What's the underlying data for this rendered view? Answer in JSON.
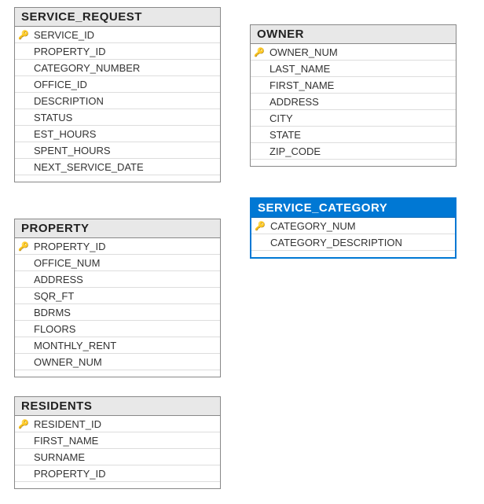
{
  "tables": {
    "service_request": {
      "title": "SERVICE_REQUEST",
      "columns": [
        {
          "name": "SERVICE_ID",
          "pk": true
        },
        {
          "name": "PROPERTY_ID",
          "pk": false
        },
        {
          "name": "CATEGORY_NUMBER",
          "pk": false
        },
        {
          "name": "OFFICE_ID",
          "pk": false
        },
        {
          "name": "DESCRIPTION",
          "pk": false
        },
        {
          "name": "STATUS",
          "pk": false
        },
        {
          "name": "EST_HOURS",
          "pk": false
        },
        {
          "name": "SPENT_HOURS",
          "pk": false
        },
        {
          "name": "NEXT_SERVICE_DATE",
          "pk": false
        }
      ]
    },
    "property": {
      "title": "PROPERTY",
      "columns": [
        {
          "name": "PROPERTY_ID",
          "pk": true
        },
        {
          "name": "OFFICE_NUM",
          "pk": false
        },
        {
          "name": "ADDRESS",
          "pk": false
        },
        {
          "name": "SQR_FT",
          "pk": false
        },
        {
          "name": "BDRMS",
          "pk": false
        },
        {
          "name": "FLOORS",
          "pk": false
        },
        {
          "name": "MONTHLY_RENT",
          "pk": false
        },
        {
          "name": "OWNER_NUM",
          "pk": false
        }
      ]
    },
    "residents": {
      "title": "RESIDENTS",
      "columns": [
        {
          "name": "RESIDENT_ID",
          "pk": true
        },
        {
          "name": "FIRST_NAME",
          "pk": false
        },
        {
          "name": "SURNAME",
          "pk": false
        },
        {
          "name": "PROPERTY_ID",
          "pk": false
        }
      ]
    },
    "owner": {
      "title": "OWNER",
      "columns": [
        {
          "name": "OWNER_NUM",
          "pk": true
        },
        {
          "name": "LAST_NAME",
          "pk": false
        },
        {
          "name": "FIRST_NAME",
          "pk": false
        },
        {
          "name": "ADDRESS",
          "pk": false
        },
        {
          "name": "CITY",
          "pk": false
        },
        {
          "name": "STATE",
          "pk": false
        },
        {
          "name": "ZIP_CODE",
          "pk": false
        }
      ]
    },
    "service_category": {
      "title": "SERVICE_CATEGORY",
      "columns": [
        {
          "name": "CATEGORY_NUM",
          "pk": true
        },
        {
          "name": "CATEGORY_DESCRIPTION",
          "pk": false
        }
      ]
    }
  },
  "key_glyph": "🔑"
}
